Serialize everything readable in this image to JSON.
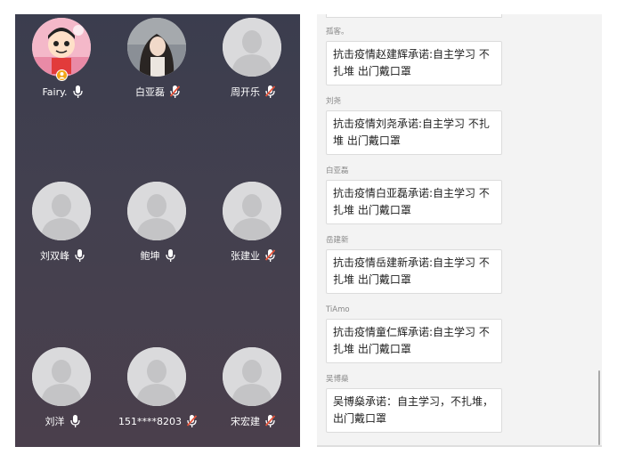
{
  "participants": [
    {
      "name": "Fairy.",
      "avatar": "cartoon",
      "mic": "on",
      "host": true
    },
    {
      "name": "白亚磊",
      "avatar": "photo",
      "mic": "off"
    },
    {
      "name": "周开乐",
      "avatar": "default",
      "mic": "off"
    },
    {
      "name": "刘双峰",
      "avatar": "default",
      "mic": "on"
    },
    {
      "name": "鲍坤",
      "avatar": "default",
      "mic": "on"
    },
    {
      "name": "张建业",
      "avatar": "default",
      "mic": "off"
    },
    {
      "name": "刘洋",
      "avatar": "default",
      "mic": "on"
    },
    {
      "name": "151****8203",
      "avatar": "default",
      "mic": "off"
    },
    {
      "name": "宋宏建",
      "avatar": "default",
      "mic": "off"
    }
  ],
  "chat": {
    "messages": [
      {
        "sender": "孤客。",
        "text": "抗击疫情赵建辉承诺:自主学习 不扎堆 出门戴口罩"
      },
      {
        "sender": "刘尧",
        "text": "抗击疫情刘尧承诺:自主学习 不扎堆 出门戴口罩"
      },
      {
        "sender": "白亚磊",
        "text": "抗击疫情白亚磊承诺:自主学习 不扎堆 出门戴口罩"
      },
      {
        "sender": "岳建新",
        "text": "抗击疫情岳建新承诺:自主学习 不扎堆 出门戴口罩"
      },
      {
        "sender": "TiAmo",
        "text": "抗击疫情童仁辉承诺:自主学习 不扎堆 出门戴口罩"
      },
      {
        "sender": "吴博燊",
        "text": "吴博燊承诺：自主学习，不扎堆，出门戴口罩"
      }
    ]
  },
  "colors": {
    "mic_on": "#ffffff",
    "mic_off": "#e5533a",
    "host_badge": "#f2a516"
  }
}
